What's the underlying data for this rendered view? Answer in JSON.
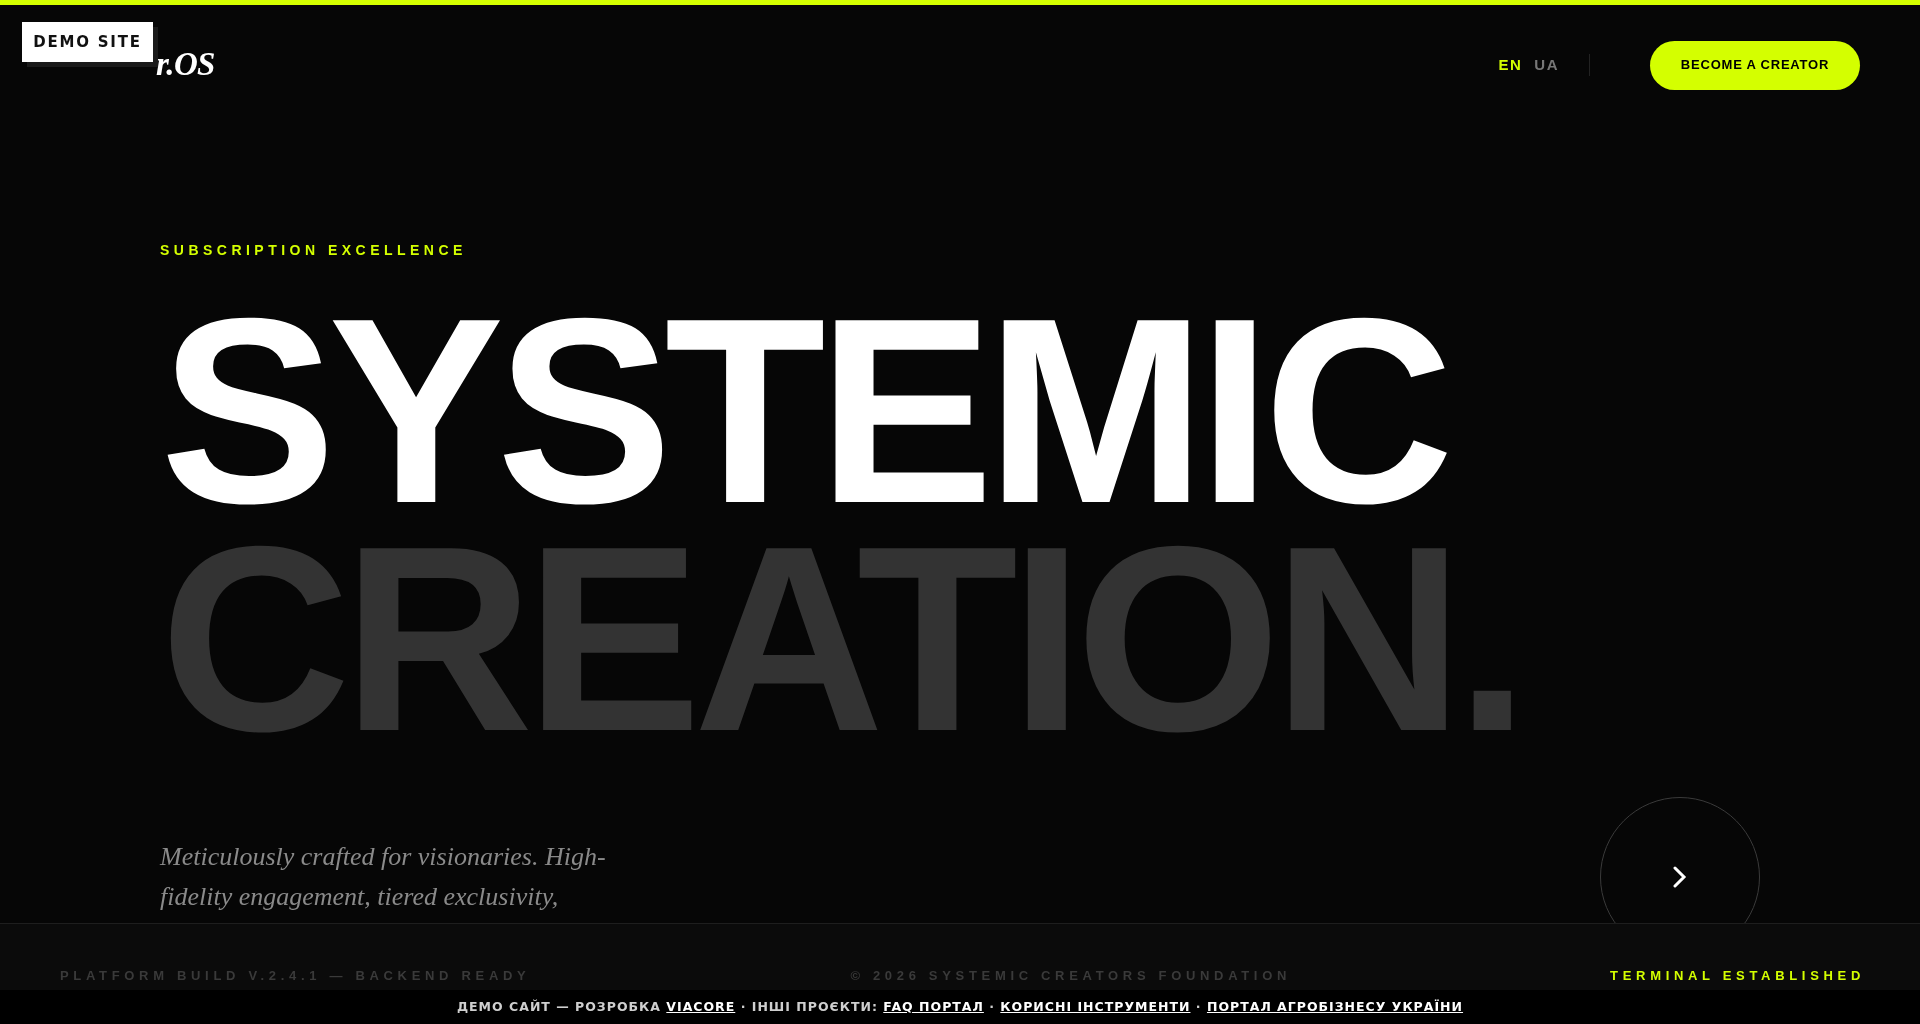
{
  "banner": {
    "label": "DEMO SITE"
  },
  "header": {
    "logo": "r.OS",
    "languages": [
      {
        "label": "EN",
        "selected": true
      },
      {
        "label": "UA",
        "selected": false
      }
    ],
    "cta": "BECOME A CREATOR"
  },
  "hero": {
    "eyebrow": "SUBSCRIPTION EXCELLENCE",
    "headline": [
      {
        "text": "SYSTEMIC",
        "kind": "primary"
      },
      {
        "text": "CREATION.",
        "kind": "muted"
      }
    ],
    "description": "Meticulously crafted for visionaries. High-fidelity engagement, tiered exclusivity,"
  },
  "footer": {
    "build": "PLATFORM BUILD V.2.4.1 — BACKEND READY",
    "copyright": "© 2026 SYSTEMIC CREATORS FOUNDATION",
    "status": "TERMINAL ESTABLISHED"
  },
  "demo_bar": [
    {
      "kind": "text",
      "text": "ДЕМО САЙТ — РОЗРОБКА "
    },
    {
      "kind": "link",
      "text": "VIACORE"
    },
    {
      "kind": "text",
      "text": " · ІНШІ ПРОЄКТИ: "
    },
    {
      "kind": "link",
      "text": "FAQ ПОРТАЛ"
    },
    {
      "kind": "text",
      "text": " · "
    },
    {
      "kind": "link",
      "text": "КОРИСНІ ІНСТРУМЕНТИ"
    },
    {
      "kind": "text",
      "text": " · "
    },
    {
      "kind": "link",
      "text": "ПОРТАЛ АГРОБІЗНЕСУ УКРАЇНИ"
    }
  ]
}
